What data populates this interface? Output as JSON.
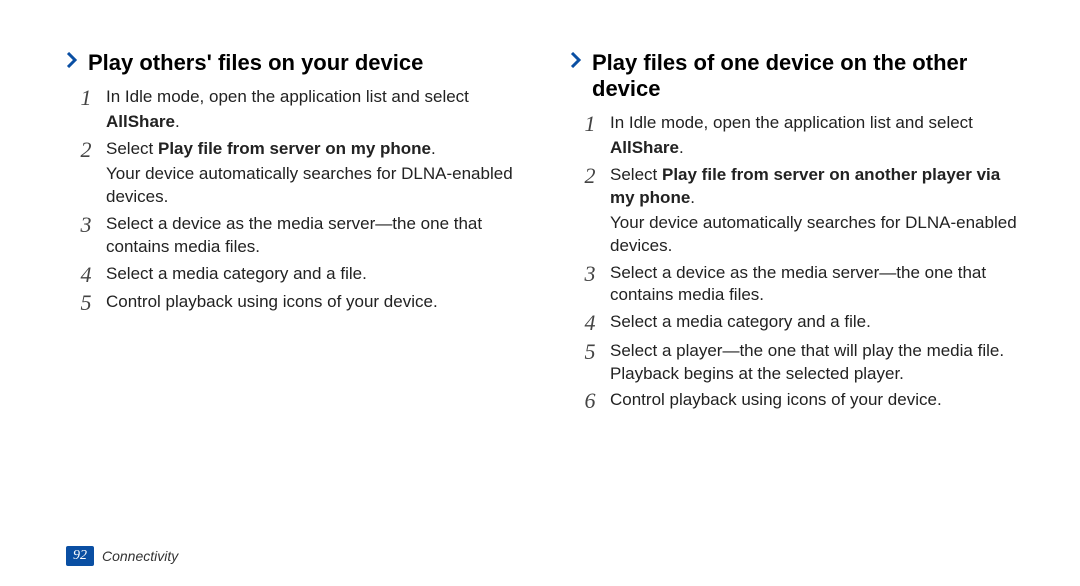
{
  "left": {
    "heading": "Play others' files on your device",
    "steps": [
      {
        "num": "1",
        "lines": [
          {
            "runs": [
              {
                "t": "In Idle mode, open the application list and select "
              }
            ]
          },
          {
            "runs": [
              {
                "t": "AllShare",
                "bold": true
              },
              {
                "t": "."
              }
            ]
          }
        ]
      },
      {
        "num": "2",
        "lines": [
          {
            "runs": [
              {
                "t": "Select "
              },
              {
                "t": "Play file from server on my phone",
                "bold": true
              },
              {
                "t": "."
              }
            ]
          },
          {
            "runs": [
              {
                "t": "Your device automatically searches for DLNA-enabled devices."
              }
            ]
          }
        ]
      },
      {
        "num": "3",
        "lines": [
          {
            "runs": [
              {
                "t": "Select a device as the media server—the one that contains media files."
              }
            ]
          }
        ]
      },
      {
        "num": "4",
        "lines": [
          {
            "runs": [
              {
                "t": "Select a media category and a file."
              }
            ]
          }
        ]
      },
      {
        "num": "5",
        "lines": [
          {
            "runs": [
              {
                "t": "Control playback using icons of your device."
              }
            ]
          }
        ]
      }
    ]
  },
  "right": {
    "heading": "Play files of one device on the other device",
    "steps": [
      {
        "num": "1",
        "lines": [
          {
            "runs": [
              {
                "t": "In Idle mode, open the application list and select "
              }
            ]
          },
          {
            "runs": [
              {
                "t": "AllShare",
                "bold": true
              },
              {
                "t": "."
              }
            ]
          }
        ]
      },
      {
        "num": "2",
        "lines": [
          {
            "runs": [
              {
                "t": "Select "
              },
              {
                "t": "Play file from server on another player via my phone",
                "bold": true
              },
              {
                "t": "."
              }
            ]
          },
          {
            "runs": [
              {
                "t": "Your device automatically searches for DLNA-enabled devices."
              }
            ]
          }
        ]
      },
      {
        "num": "3",
        "lines": [
          {
            "runs": [
              {
                "t": "Select a device as the media server—the one that contains media files."
              }
            ]
          }
        ]
      },
      {
        "num": "4",
        "lines": [
          {
            "runs": [
              {
                "t": "Select a media category and a file."
              }
            ]
          }
        ]
      },
      {
        "num": "5",
        "lines": [
          {
            "runs": [
              {
                "t": "Select a player—the one that will play the media file. Playback begins at the selected player."
              }
            ]
          }
        ]
      },
      {
        "num": "6",
        "lines": [
          {
            "runs": [
              {
                "t": "Control playback using icons of your device."
              }
            ]
          }
        ]
      }
    ]
  },
  "footer": {
    "page_number": "92",
    "section": "Connectivity"
  }
}
